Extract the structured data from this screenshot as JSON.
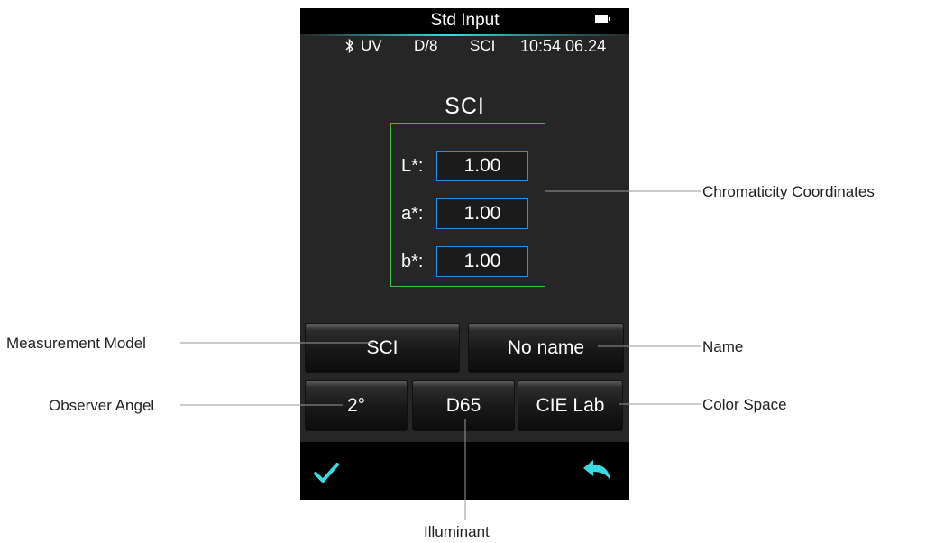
{
  "screen": {
    "title": "Std Input",
    "status": {
      "uv": "UV",
      "geometry": "D/8",
      "mode": "SCI",
      "time": "10:54 06.24"
    },
    "heading": "SCI",
    "coordinates": [
      {
        "label": "L*:",
        "value": "1.00"
      },
      {
        "label": "a*:",
        "value": "1.00"
      },
      {
        "label": "b*:",
        "value": "1.00"
      }
    ],
    "buttons": {
      "measurement_model": "SCI",
      "name": "No name",
      "observer_angle": "2°",
      "illuminant": "D65",
      "color_space": "CIE Lab"
    },
    "accent_color": "#3bd9e0",
    "icons": {
      "confirm": "check-icon",
      "back": "back-arrow-icon",
      "bluetooth": "bluetooth-icon",
      "battery": "battery-icon"
    }
  },
  "callouts": {
    "chromaticity": "Chromaticity  Coordinates",
    "measurement_model": "Measurement Model",
    "name": "Name",
    "observer_angle": "Observer Angel",
    "color_space": "Color Space",
    "illuminant": "Illuminant"
  }
}
